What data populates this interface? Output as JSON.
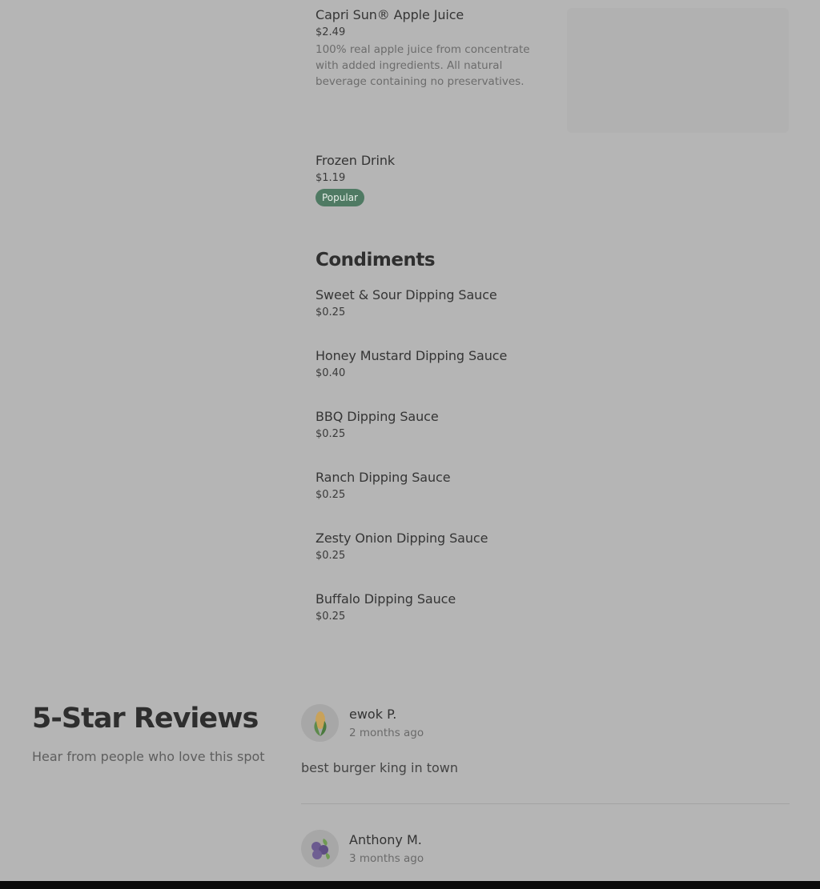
{
  "menu": {
    "items": [
      {
        "name": "Capri Sun® Apple Juice",
        "price": "$2.49",
        "description": "100% real apple juice from concentrate with added ingredients. All natural beverage containing no preservatives."
      },
      {
        "name": "Frozen Drink",
        "price": "$1.19",
        "badge": "Popular"
      }
    ],
    "condiments": {
      "title": "Condiments",
      "items": [
        {
          "name": "Sweet & Sour Dipping Sauce",
          "price": "$0.25"
        },
        {
          "name": "Honey Mustard Dipping Sauce",
          "price": "$0.40"
        },
        {
          "name": "BBQ Dipping Sauce",
          "price": "$0.25"
        },
        {
          "name": "Ranch Dipping Sauce",
          "price": "$0.25"
        },
        {
          "name": "Zesty Onion Dipping Sauce",
          "price": "$0.25"
        },
        {
          "name": "Buffalo Dipping Sauce",
          "price": "$0.25"
        }
      ]
    }
  },
  "reviews": {
    "title": "5-Star Reviews",
    "subtitle": "Hear from people who love this spot",
    "items": [
      {
        "name": "ewok P.",
        "time": "2 months ago",
        "text": "best burger king in town",
        "avatar_icon": "corn-icon"
      },
      {
        "name": "Anthony M.",
        "time": "3 months ago",
        "avatar_icon": "blueberry-icon"
      }
    ]
  },
  "colors": {
    "badge": "#4f7a63",
    "overlay_bg": "#b5b5b5"
  }
}
